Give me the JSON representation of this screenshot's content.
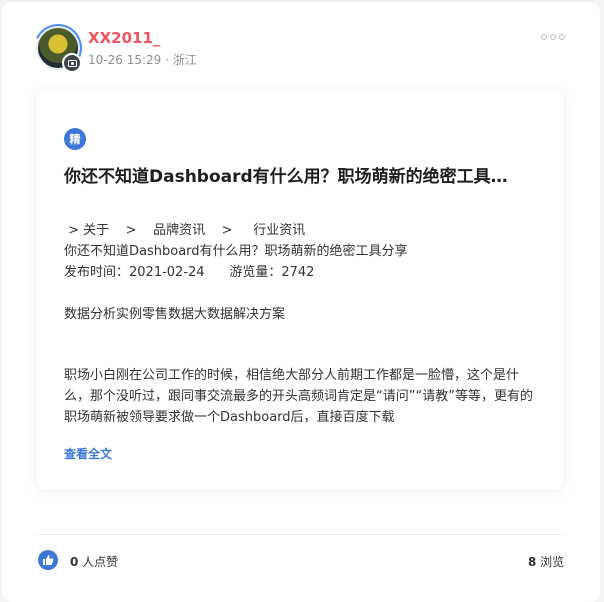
{
  "post": {
    "username": "XX2011_",
    "timestamp": "10-26 15:29",
    "separator": "·",
    "location": "浙江"
  },
  "article": {
    "badge": "精",
    "title": "你还不知道Dashboard有什么用？职场萌新的绝密工具…",
    "breadcrumb": " > 关于    >    品牌资讯    >     行业资讯",
    "subtitle": "你还不知道Dashboard有什么用？职场萌新的绝密工具分享",
    "publish_info": "发布时间：2021-02-24      游览量：2742",
    "category": "数据分析实例零售数据大数据解决方案",
    "body": "职场小白刚在公司工作的时候，相信绝大部分人前期工作都是一脸懵，这个是什么，那个没听过，跟同事交流最多的开头高频词肯定是“请问”“请教”等等，更有的职场萌新被领导要求做一个Dashboard后，直接百度下载",
    "read_more": "查看全文"
  },
  "footer": {
    "like_count": "0",
    "like_label": " 人点赞",
    "view_count": "8",
    "view_label": " 浏览"
  },
  "icons": {
    "avatar_badge": "camera-icon",
    "more": "more-icon",
    "like": "thumbs-up-icon"
  },
  "colors": {
    "username": "#f0545f",
    "accent": "#3c78d8"
  }
}
